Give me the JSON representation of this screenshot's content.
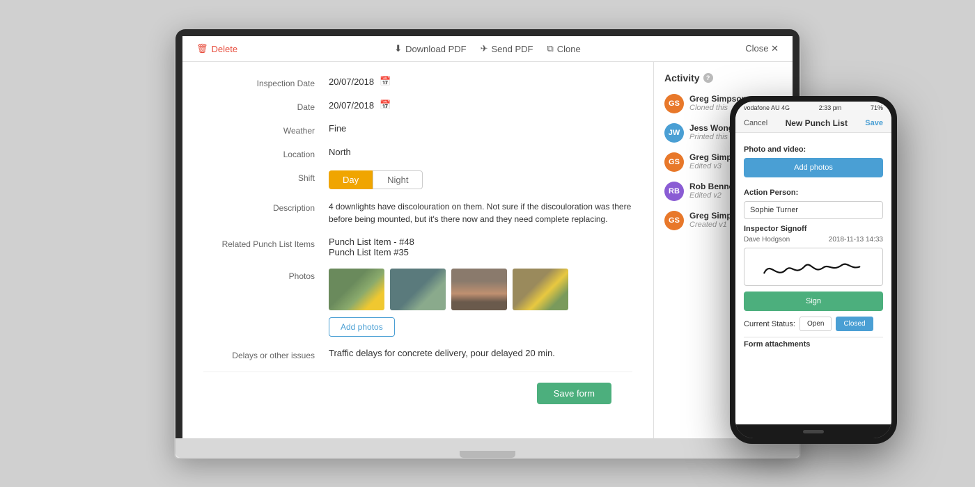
{
  "toolbar": {
    "delete_label": "Delete",
    "download_pdf_label": "Download PDF",
    "send_pdf_label": "Send PDF",
    "clone_label": "Clone",
    "close_label": "Close"
  },
  "form": {
    "inspection_date_label": "Inspection Date",
    "inspection_date_value": "20/07/2018",
    "date_label": "Date",
    "date_value": "20/07/2018",
    "weather_label": "Weather",
    "weather_value": "Fine",
    "location_label": "Location",
    "location_value": "North",
    "shift_label": "Shift",
    "shift_day": "Day",
    "shift_night": "Night",
    "description_label": "Description",
    "description_value": "4 downlights have discolouration on them. Not sure if the discouloration was there before being mounted, but it's there now and they need complete replacing.",
    "related_label": "Related Punch List Items",
    "related_item1": "Punch List Item - #48",
    "related_item2": "Punch List Item #35",
    "photos_label": "Photos",
    "add_photos_label": "Add photos",
    "delays_label": "Delays or other issues",
    "delays_value": "Traffic delays for concrete delivery, pour delayed 20 min.",
    "save_form_label": "Save form"
  },
  "activity": {
    "title": "Activity",
    "help_icon": "?",
    "items": [
      {
        "initials": "GS",
        "name": "Greg Simpson",
        "action": "Cloned this",
        "avatar_color": "orange"
      },
      {
        "initials": "JW",
        "name": "Jess Wong",
        "action": "Printed this",
        "avatar_color": "blue"
      },
      {
        "initials": "GS",
        "name": "Greg Simpso...",
        "action": "Edited v3",
        "avatar_color": "orange"
      },
      {
        "initials": "RB",
        "name": "Rob Bennet...",
        "action": "Edited v2",
        "avatar_color": "purple"
      },
      {
        "initials": "GS",
        "name": "Greg Simpso...",
        "action": "Created v1",
        "avatar_color": "orange"
      }
    ]
  },
  "phone": {
    "status_bar": {
      "carrier": "vodafone AU  4G",
      "time": "2:33 pm",
      "battery": "71%"
    },
    "nav": {
      "cancel": "Cancel",
      "title": "New Punch List",
      "save": "Save"
    },
    "photo_video_label": "Photo and video:",
    "add_photos_label": "Add photos",
    "action_person_label": "Action Person:",
    "action_person_value": "Sophie Turner",
    "inspector_signoff_label": "Inspector Signoff",
    "signoff_name": "Dave Hodgson",
    "signoff_date": "2018-11-13 14:33",
    "sign_label": "Sign",
    "current_status_label": "Current Status:",
    "status_open": "Open",
    "status_closed": "Closed",
    "form_attachments_label": "Form attachments"
  }
}
